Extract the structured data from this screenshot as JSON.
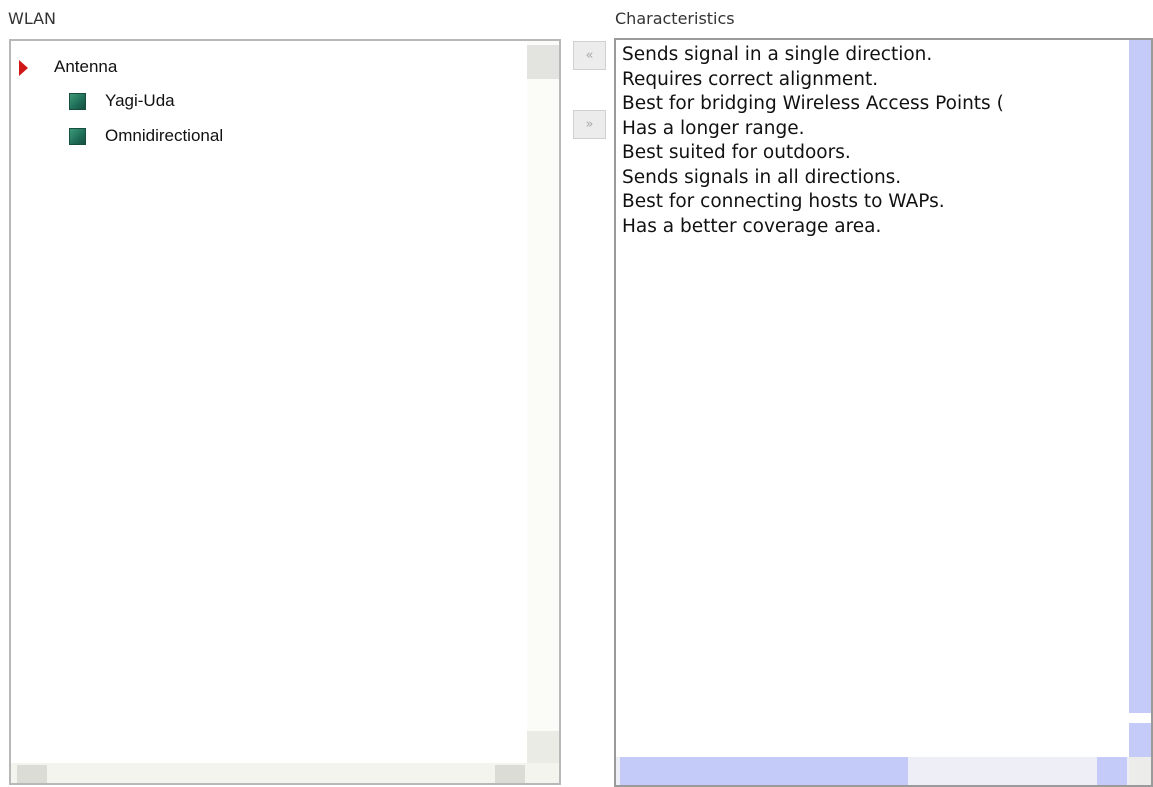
{
  "left_panel": {
    "heading": "WLAN",
    "tree": {
      "root": "Antenna",
      "children": [
        "Yagi-Uda",
        "Omnidirectional"
      ]
    }
  },
  "transfer_buttons": {
    "move_left": "«",
    "move_right": "»"
  },
  "right_panel": {
    "heading": "Characteristics",
    "items": [
      "Sends signal in a single direction.",
      "Requires correct alignment.",
      "Best for bridging Wireless Access Points (",
      "Has a longer range.",
      "Best suited for outdoors.",
      "Sends signals in all directions.",
      "Best for connecting hosts to WAPs.",
      "Has a better coverage area."
    ]
  },
  "colors": {
    "arrow": "#d01818",
    "node_square": "#1e6b55",
    "scrollbar": "#c4cbf8"
  }
}
